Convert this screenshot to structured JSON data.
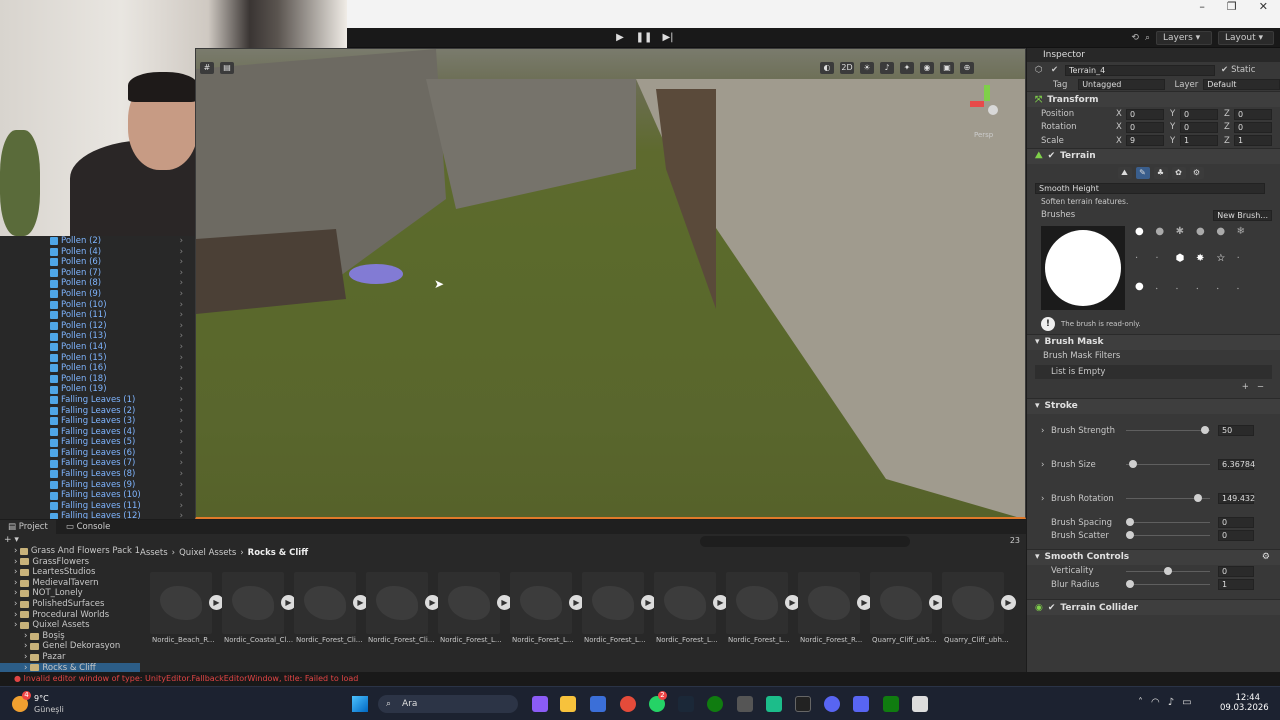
{
  "webcam": {
    "label": "Webcam overlay"
  },
  "toolbar": {
    "layers_label": "Layers",
    "layout_label": "Layout",
    "play_icon": "play-icon",
    "pause_icon": "pause-icon",
    "step_icon": "step-icon"
  },
  "scene": {
    "mode_2d": "2D",
    "persp_label": "Persp"
  },
  "hierarchy": {
    "items": [
      "Pollen (2)",
      "Pollen (4)",
      "Pollen (6)",
      "Pollen (7)",
      "Pollen (8)",
      "Pollen (9)",
      "Pollen (10)",
      "Pollen (11)",
      "Pollen (12)",
      "Pollen (13)",
      "Pollen (14)",
      "Pollen (15)",
      "Pollen (16)",
      "Pollen (18)",
      "Pollen (19)",
      "Falling Leaves (1)",
      "Falling Leaves (2)",
      "Falling Leaves (3)",
      "Falling Leaves (4)",
      "Falling Leaves (5)",
      "Falling Leaves (6)",
      "Falling Leaves (7)",
      "Falling Leaves (8)",
      "Falling Leaves (9)",
      "Falling Leaves (10)",
      "Falling Leaves (11)",
      "Falling Leaves (12)"
    ]
  },
  "inspector": {
    "tab_label": "Inspector",
    "object_name": "Terrain_4",
    "static_label": "Static",
    "tag_label": "Tag",
    "tag_value": "Untagged",
    "layer_label": "Layer",
    "layer_value": "Default",
    "transform": {
      "title": "Transform",
      "position_label": "Position",
      "px": "0",
      "py": "0",
      "pz": "0",
      "rotation_label": "Rotation",
      "rx": "0",
      "ry": "0",
      "rz": "0",
      "scale_label": "Scale",
      "sx": "9",
      "sy": "1",
      "sz": "1",
      "x": "X",
      "y": "Y",
      "z": "Z"
    },
    "terrain": {
      "title": "Terrain",
      "tool_value": "Smooth Height",
      "tool_desc": "Soften terrain features.",
      "brushes_label": "Brushes",
      "new_brush_label": "New Brush...",
      "readonly_note": "The brush is read-only.",
      "brush_mask_label": "Brush Mask",
      "brush_mask_filters_label": "Brush Mask Filters",
      "list_empty": "List is Empty",
      "stroke_label": "Stroke",
      "brush_strength_label": "Brush Strength",
      "brush_strength_value": "50",
      "brush_strength_frac": 0.99,
      "brush_size_label": "Brush Size",
      "brush_size_value": "6.36784",
      "brush_size_frac": 0.04,
      "brush_rotation_label": "Brush Rotation",
      "brush_rotation_value": "149.432",
      "brush_rotation_frac": 0.9,
      "brush_spacing_label": "Brush Spacing",
      "brush_spacing_value": "0",
      "brush_spacing_frac": 0.0,
      "brush_scatter_label": "Brush Scatter",
      "brush_scatter_value": "0",
      "brush_scatter_frac": 0.0,
      "smooth_controls_label": "Smooth Controls",
      "verticality_label": "Verticality",
      "verticality_value": "0",
      "verticality_frac": 0.5,
      "blur_radius_label": "Blur Radius",
      "blur_radius_value": "1",
      "blur_radius_frac": 0.0
    },
    "terrain_collider": {
      "title": "Terrain Collider"
    }
  },
  "bottom": {
    "project_tab": "Project",
    "console_tab": "Console",
    "count_badge": "23",
    "breadcrumb": [
      "Assets",
      "Quixel Assets",
      "Rocks & Cliff"
    ],
    "tree": [
      {
        "label": "Grass And Flowers Pack 1",
        "indent": 1
      },
      {
        "label": "GrassFlowers",
        "indent": 1
      },
      {
        "label": "LeartesStudios",
        "indent": 1
      },
      {
        "label": "MedievalTavern",
        "indent": 1
      },
      {
        "label": "NOT_Lonely",
        "indent": 1
      },
      {
        "label": "PolishedSurfaces",
        "indent": 1
      },
      {
        "label": "Procedural Worlds",
        "indent": 1
      },
      {
        "label": "Quixel Assets",
        "indent": 1
      },
      {
        "label": "Boşiş",
        "indent": 2
      },
      {
        "label": "Genel Dekorasyon",
        "indent": 2
      },
      {
        "label": "Pazar",
        "indent": 2
      },
      {
        "label": "Rocks & Cliff",
        "indent": 2
      }
    ],
    "assets": [
      "Nordic_Beach_R...",
      "Nordic_Coastal_Cl...",
      "Nordic_Forest_Cli...",
      "Nordic_Forest_Cli...",
      "Nordic_Forest_L...",
      "Nordic_Forest_L...",
      "Nordic_Forest_L...",
      "Nordic_Forest_L...",
      "Nordic_Forest_L...",
      "Nordic_Forest_R...",
      "Quarry_Cliff_ub5...",
      "Quarry_Cliff_ubh..."
    ]
  },
  "status": {
    "error_text": "Invalid editor window of type: UnityEditor.FallbackEditorWindow, title: Failed to load"
  },
  "taskbar": {
    "weather_temp": "9°C",
    "weather_desc": "Güneşli",
    "search_label": "Ara",
    "time": "12:44",
    "date": "09.03.2026",
    "whatsapp_badge": "2",
    "weather_badge": "4"
  }
}
